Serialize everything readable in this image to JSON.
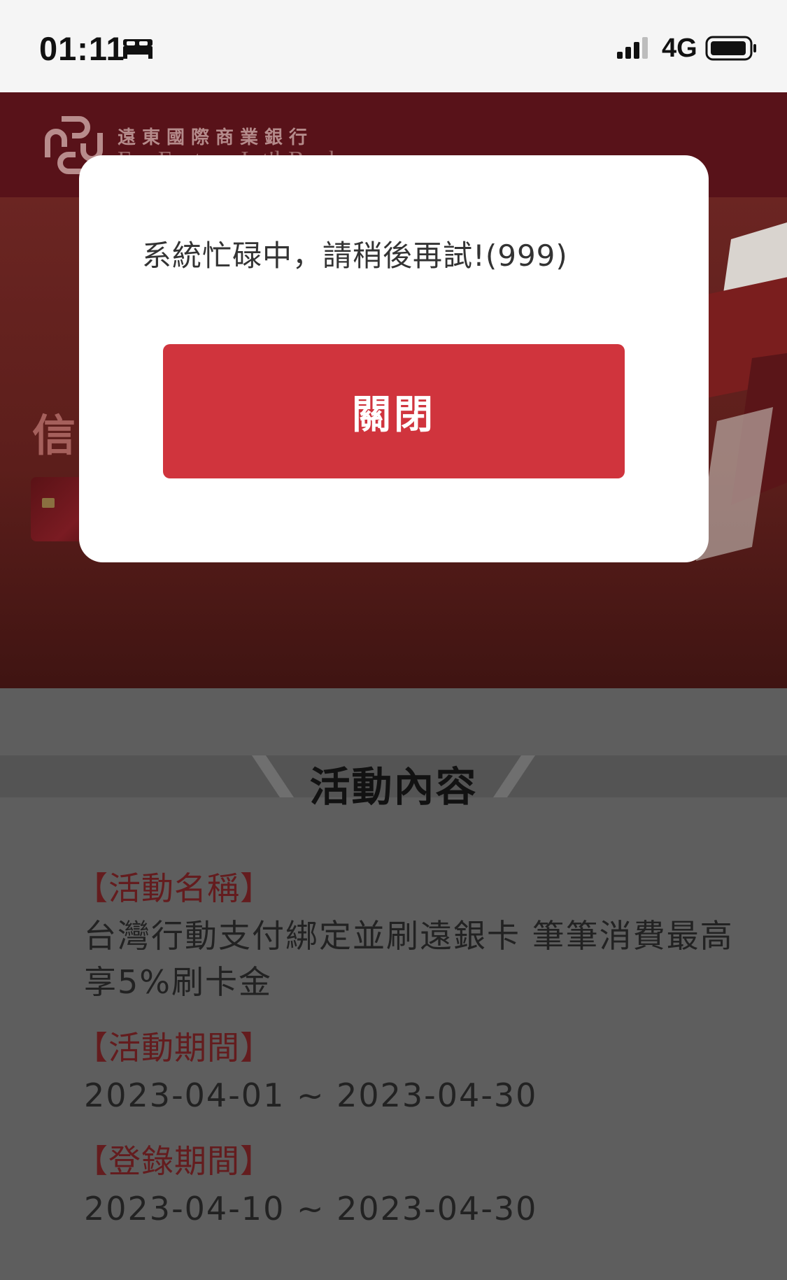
{
  "status_bar": {
    "time": "01:11",
    "network": "4G",
    "icons": [
      "bed-icon",
      "signal-bars-icon",
      "battery-icon"
    ]
  },
  "bank": {
    "name_zh": "遠東國際商業銀行",
    "name_en": "Far Eastern Int'l Bank",
    "logo": "bank-logo-icon"
  },
  "banner": {
    "title_visible": "信"
  },
  "section": {
    "title": "活動內容"
  },
  "details": [
    {
      "label": "【活動名稱】",
      "value": "台灣行動支付綁定並刷遠銀卡 筆筆消費最高享5%刷卡金"
    },
    {
      "label": "【活動期間】",
      "value": "2023-04-01 ~ 2023-04-30"
    },
    {
      "label": "【登錄期間】",
      "value": "2023-04-10 ~ 2023-04-30"
    }
  ],
  "dialog": {
    "message": "系統忙碌中，請稍後再試!(999)",
    "close_label": "關閉"
  },
  "colors": {
    "header_bg": "#581219",
    "button_bg": "#d0343d",
    "label_color": "#641c1e"
  }
}
